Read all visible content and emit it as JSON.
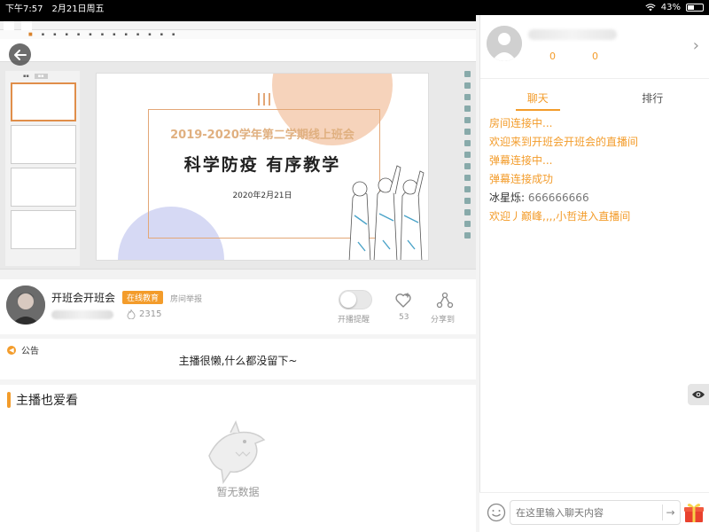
{
  "status_bar": {
    "time": "下午7:57",
    "date": "2月21日周五",
    "battery": "43%",
    "battery_level": 0.43
  },
  "slide": {
    "title": "2019-2020学年第二学期线上班会",
    "subtitle": "科学防疫 有序教学",
    "date": "2020年2月21日"
  },
  "room": {
    "title": "开班会开班会",
    "tag": "在线教育",
    "report_label": "房间举报",
    "viewers": "2315",
    "remind_label": "开播提醒",
    "remind_on": false,
    "likes": "53",
    "share_label": "分享到"
  },
  "notice": {
    "label": "公告",
    "text": "主播很懒,什么都没留下~"
  },
  "also_watch": {
    "title": "主播也爱看",
    "empty_text": "暂无数据"
  },
  "host": {
    "count1": "0",
    "count2": "0"
  },
  "tabs": [
    {
      "label": "聊天",
      "active": true
    },
    {
      "label": "排行",
      "active": false
    }
  ],
  "chat": {
    "system": [
      "房间连接中...",
      "欢迎来到开班会开班会的直播间",
      "弹幕连接中...",
      "弹幕连接成功"
    ],
    "user_name": "冰星烁: ",
    "user_msg": "666666666",
    "welcome": "欢迎丿巅峰,,,,小哲进入直播间"
  },
  "input": {
    "placeholder": "在这里输入聊天内容"
  },
  "colors": {
    "accent": "#f39c2b"
  }
}
